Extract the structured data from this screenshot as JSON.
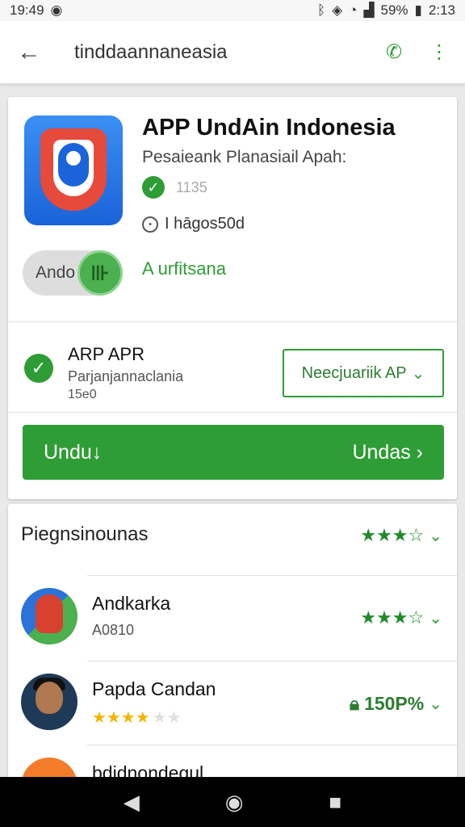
{
  "status_bar": {
    "time": "19:49",
    "battery": "59%",
    "clock": "2:13"
  },
  "app_bar": {
    "title": "tinddaannaneasia"
  },
  "app": {
    "name": "APP UndAin Indonesia",
    "subtitle": "Pesaieank Planasiail Apah:",
    "verified_text": "1135",
    "location": "I hāgos50d",
    "toggle_label": "Ando",
    "toggle_text": "A urfitsana"
  },
  "release": {
    "title": "ARP APR",
    "subtitle": "Parjanjannaclania",
    "number": "15e0",
    "dropdown_label": "Neecjuariik AP"
  },
  "primary_button": {
    "left_label": "Undu↓",
    "right_label": "Undas"
  },
  "reviews": {
    "section_title": "Piegnsinounas",
    "items": [
      {
        "name": "Andkarka",
        "sub": "A0810"
      },
      {
        "name": "Papda Candan",
        "percent": "150P%"
      },
      {
        "name": "bdidnondegul"
      }
    ]
  },
  "colors": {
    "accent": "#2e9d35",
    "star_yellow": "#f4b400"
  }
}
